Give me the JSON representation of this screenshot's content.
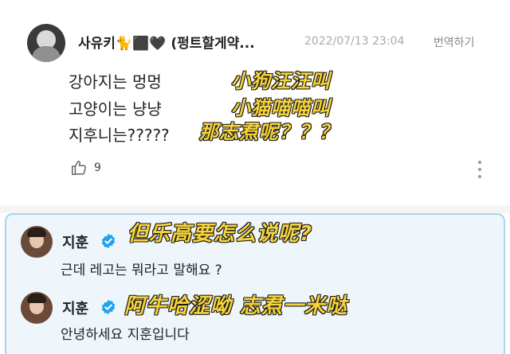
{
  "post": {
    "username": "사유키🐈⬛🖤 (펑트할게약...",
    "timestamp": "2022/07/13 23:04",
    "translate_label": "번역하기",
    "lines": [
      "강아지는 멍멍",
      "고양이는 냥냥",
      "지후니는?????"
    ],
    "subtitles": [
      "小狗汪汪叫",
      "小猫喵喵叫",
      "那志焄呢？？？"
    ],
    "like_count": "9",
    "icons": {
      "like": "thumbs-up-icon",
      "more": "more-vertical-icon"
    }
  },
  "comments": [
    {
      "author": "지훈",
      "text": "근데 레고는 뭐라고 말해요 ?",
      "subtitle": "但乐高要怎么说呢?"
    },
    {
      "author": "지훈",
      "text": "안녕하세요 지훈입니다",
      "subtitle": "阿牛哈涩呦 志焄一米哒"
    }
  ],
  "colors": {
    "subtitle_fill": "#f5d33a",
    "subtitle_stroke": "#1a1a1a",
    "verified": "#1da1f2",
    "comment_bg": "#eef5fb",
    "comment_border": "#a8d4ee"
  }
}
